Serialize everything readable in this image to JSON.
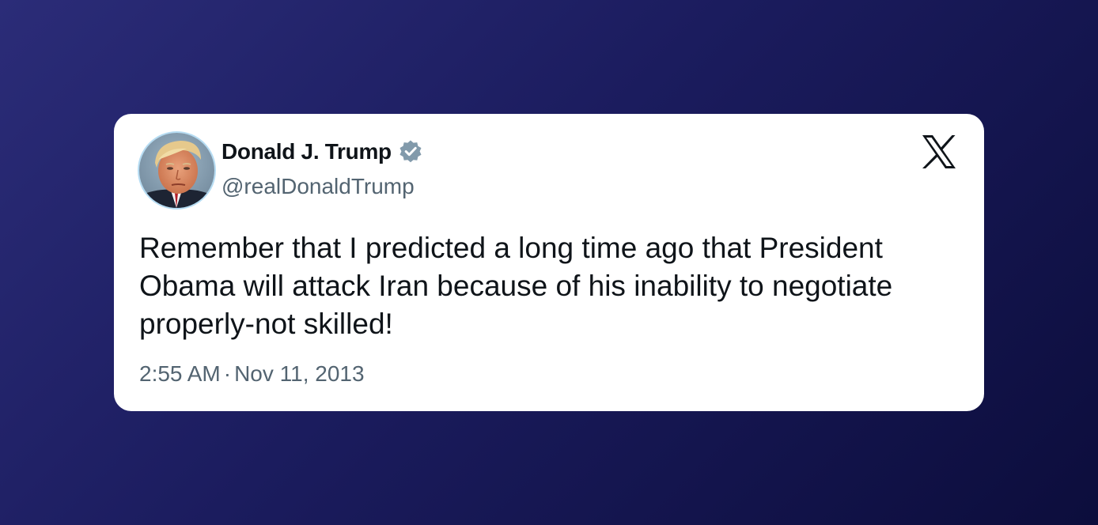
{
  "tweet": {
    "author_name": "Donald J. Trump",
    "handle": "@realDonaldTrump",
    "text": "Remember that I predicted a long time ago that President Obama will attack Iran because of his inability to negotiate properly-not skilled!",
    "time": "2:55 AM",
    "separator": "·",
    "date": "Nov 11, 2013",
    "verified_icon": "verified-badge-icon",
    "platform_icon": "x-logo-icon"
  },
  "colors": {
    "background_start": "#2b2c78",
    "background_end": "#0c0d3c",
    "card": "#ffffff",
    "text_primary": "#0f1419",
    "text_secondary": "#536471",
    "verified_badge": "#829aab"
  }
}
